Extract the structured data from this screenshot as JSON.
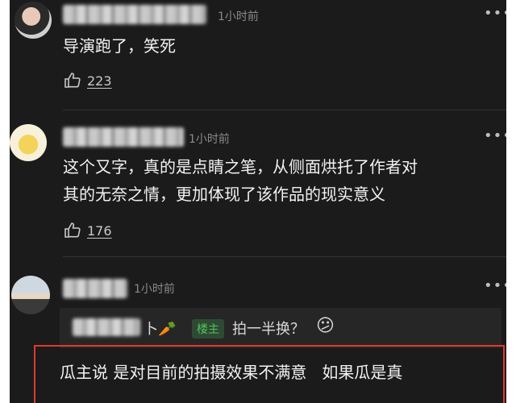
{
  "comments": [
    {
      "time": "1小时前",
      "more": "•••",
      "text": "导演跑了，笑死",
      "likes": "223"
    },
    {
      "time": "1小时前",
      "more": "•••",
      "text_lines": [
        "这个又字，真的是点睛之笔，从侧面烘托了作者对",
        "其的无奈之情，更加体现了该作品的现实意义"
      ],
      "likes": "176"
    },
    {
      "time": "1小时前",
      "more": "•••",
      "reply": {
        "name_tail": "卜🥕",
        "owner_badge": "楼主",
        "text": "拍一半换？",
        "emoji": "😕"
      },
      "highlighted_text": "瓜主说 是对目前的拍摄效果不满意   如果瓜是真"
    }
  ],
  "colors": {
    "background": "#1b1b1b",
    "highlight_border": "#e03a2f",
    "owner_badge": "#4ec35b"
  },
  "icons": [
    "thumbs-up-icon",
    "more-icon"
  ]
}
